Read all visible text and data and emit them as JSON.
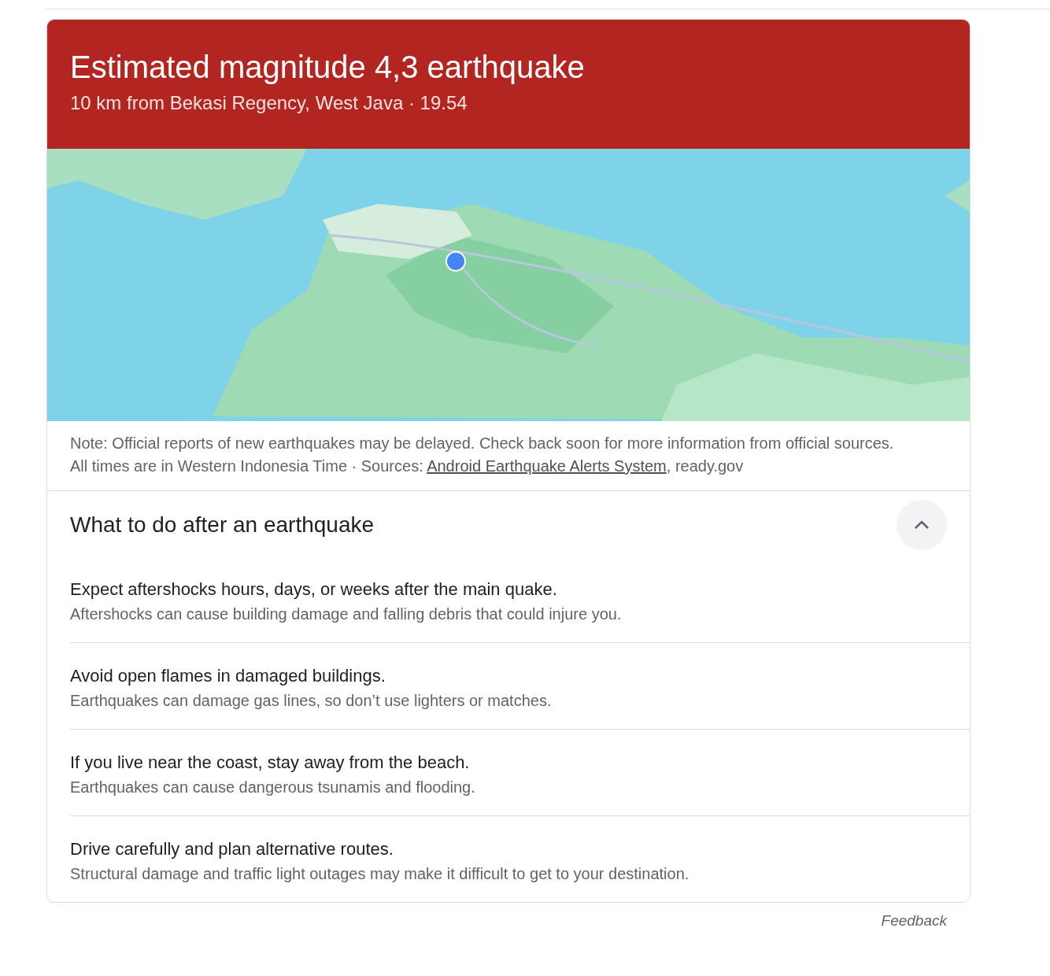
{
  "header": {
    "title": "Estimated magnitude 4,3 earthquake",
    "subtitle": "10 km from Bekasi Regency, West Java · 19.54"
  },
  "note": {
    "text": "Note: Official reports of new earthquakes may be delayed. Check back soon for more information from official sources.",
    "times": "All times are in Western Indonesia Time · Sources: ",
    "source_link": "Android Earthquake Alerts System",
    "source_rest": ", ready.gov"
  },
  "section": {
    "title": "What to do after an earthquake",
    "expanded": true,
    "items": [
      {
        "title": "Expect aftershocks hours, days, or weeks after the main quake.",
        "text": "Aftershocks can cause building damage and falling debris that could injure you."
      },
      {
        "title": "Avoid open flames in damaged buildings.",
        "text": "Earthquakes can damage gas lines, so don’t use lighters or matches."
      },
      {
        "title": "If you live near the coast, stay away from the beach.",
        "text": "Earthquakes can cause dangerous tsunamis and flooding."
      },
      {
        "title": "Drive carefully and plan alternative routes.",
        "text": "Structural damage and traffic light outages may make it difficult to get to your destination."
      }
    ]
  },
  "feedback": "Feedback"
}
